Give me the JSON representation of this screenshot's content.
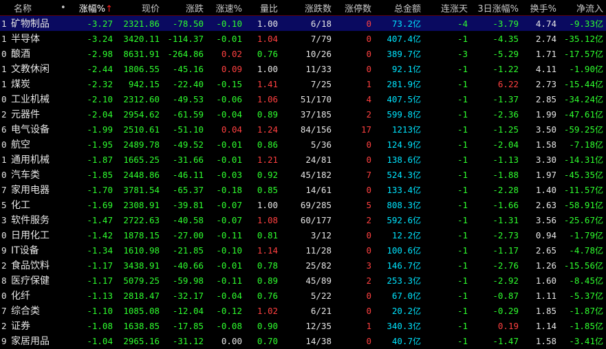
{
  "headers": {
    "name": "名称",
    "dot": "•",
    "change_pct": "涨幅%",
    "sort_arrow": "↑",
    "price": "现价",
    "change": "涨跌",
    "speed": "涨速%",
    "volume_ratio": "量比",
    "up_down_count": "涨跌数",
    "limit_up": "涨停数",
    "total_amount": "总金额",
    "consecutive": "连涨天",
    "three_day": "3日涨幅%",
    "turnover": "换手%",
    "net_inflow": "净流入"
  },
  "colors": {
    "up": "#ff4040",
    "down": "#2fff2f",
    "amount": "#00e5ff",
    "selected_row_bg": "#0a0a60"
  },
  "rows": [
    {
      "idx": "1",
      "name": "矿物制品",
      "pct": "-3.27",
      "price": "2321.86",
      "chg": "-78.50",
      "speed": "-0.10",
      "ratio": "1.00",
      "count": "6/18",
      "limit": "0",
      "amount": "73.2",
      "unit": "亿",
      "days": "-4",
      "three": "-3.79",
      "turn": "4.74",
      "net": "-9.33",
      "net_unit": "亿"
    },
    {
      "idx": "1",
      "name": "半导体",
      "pct": "-3.24",
      "price": "3420.11",
      "chg": "-114.37",
      "speed": "-0.01",
      "ratio": "1.04",
      "count": "7/79",
      "limit": "0",
      "amount": "407.4",
      "unit": "亿",
      "days": "-1",
      "three": "-4.35",
      "turn": "2.74",
      "net": "-35.12",
      "net_unit": "亿"
    },
    {
      "idx": "0",
      "name": "酿酒",
      "pct": "-2.98",
      "price": "8631.91",
      "chg": "-264.86",
      "speed": "0.02",
      "ratio": "0.76",
      "count": "10/26",
      "limit": "0",
      "amount": "389.7",
      "unit": "亿",
      "days": "-3",
      "three": "-5.29",
      "turn": "1.71",
      "net": "-17.57",
      "net_unit": "亿"
    },
    {
      "idx": "1",
      "name": "文教休闲",
      "pct": "-2.44",
      "price": "1806.55",
      "chg": "-45.16",
      "speed": "0.09",
      "ratio": "1.00",
      "count": "11/33",
      "limit": "0",
      "amount": "92.1",
      "unit": "亿",
      "days": "-1",
      "three": "-1.22",
      "turn": "4.11",
      "net": "-1.90",
      "net_unit": "亿"
    },
    {
      "idx": "1",
      "name": "煤炭",
      "pct": "-2.32",
      "price": "942.15",
      "chg": "-22.40",
      "speed": "-0.15",
      "ratio": "1.41",
      "count": "7/25",
      "limit": "1",
      "amount": "281.9",
      "unit": "亿",
      "days": "-1",
      "three": "6.22",
      "turn": "2.73",
      "net": "-15.44",
      "net_unit": "亿"
    },
    {
      "idx": "0",
      "name": "工业机械",
      "pct": "-2.10",
      "price": "2312.60",
      "chg": "-49.53",
      "speed": "-0.06",
      "ratio": "1.06",
      "count": "51/170",
      "limit": "4",
      "amount": "407.5",
      "unit": "亿",
      "days": "-1",
      "three": "-1.37",
      "turn": "2.85",
      "net": "-34.24",
      "net_unit": "亿"
    },
    {
      "idx": "2",
      "name": "元器件",
      "pct": "-2.04",
      "price": "2954.62",
      "chg": "-61.59",
      "speed": "-0.04",
      "ratio": "0.89",
      "count": "37/185",
      "limit": "2",
      "amount": "599.8",
      "unit": "亿",
      "days": "-1",
      "three": "-2.36",
      "turn": "1.99",
      "net": "-47.61",
      "net_unit": "亿"
    },
    {
      "idx": "6",
      "name": "电气设备",
      "pct": "-1.99",
      "price": "2510.61",
      "chg": "-51.10",
      "speed": "0.04",
      "ratio": "1.24",
      "count": "84/156",
      "limit": "17",
      "amount": "1213",
      "unit": "亿",
      "days": "-1",
      "three": "-1.25",
      "turn": "3.50",
      "net": "-59.25",
      "net_unit": "亿"
    },
    {
      "idx": "0",
      "name": "航空",
      "pct": "-1.95",
      "price": "2489.78",
      "chg": "-49.52",
      "speed": "-0.01",
      "ratio": "0.86",
      "count": "5/36",
      "limit": "0",
      "amount": "124.9",
      "unit": "亿",
      "days": "-1",
      "three": "-2.04",
      "turn": "1.58",
      "net": "-7.18",
      "net_unit": "亿"
    },
    {
      "idx": "1",
      "name": "通用机械",
      "pct": "-1.87",
      "price": "1665.25",
      "chg": "-31.66",
      "speed": "-0.01",
      "ratio": "1.21",
      "count": "24/81",
      "limit": "0",
      "amount": "138.6",
      "unit": "亿",
      "days": "-1",
      "three": "-1.13",
      "turn": "3.30",
      "net": "-14.31",
      "net_unit": "亿"
    },
    {
      "idx": "0",
      "name": "汽车类",
      "pct": "-1.85",
      "price": "2448.86",
      "chg": "-46.11",
      "speed": "-0.03",
      "ratio": "0.92",
      "count": "45/182",
      "limit": "7",
      "amount": "524.3",
      "unit": "亿",
      "days": "-1",
      "three": "-1.88",
      "turn": "1.97",
      "net": "-45.35",
      "net_unit": "亿"
    },
    {
      "idx": "7",
      "name": "家用电器",
      "pct": "-1.70",
      "price": "3781.54",
      "chg": "-65.37",
      "speed": "-0.18",
      "ratio": "0.85",
      "count": "14/61",
      "limit": "0",
      "amount": "133.4",
      "unit": "亿",
      "days": "-1",
      "three": "-2.28",
      "turn": "1.40",
      "net": "-11.57",
      "net_unit": "亿"
    },
    {
      "idx": "5",
      "name": "化工",
      "pct": "-1.69",
      "price": "2308.91",
      "chg": "-39.81",
      "speed": "-0.07",
      "ratio": "1.00",
      "count": "69/285",
      "limit": "5",
      "amount": "808.3",
      "unit": "亿",
      "days": "-1",
      "three": "-1.66",
      "turn": "2.63",
      "net": "-58.91",
      "net_unit": "亿"
    },
    {
      "idx": "3",
      "name": "软件服务",
      "pct": "-1.47",
      "price": "2722.63",
      "chg": "-40.58",
      "speed": "-0.07",
      "ratio": "1.08",
      "count": "60/177",
      "limit": "2",
      "amount": "592.6",
      "unit": "亿",
      "days": "-1",
      "three": "-1.31",
      "turn": "3.56",
      "net": "-25.67",
      "net_unit": "亿"
    },
    {
      "idx": "0",
      "name": "日用化工",
      "pct": "-1.42",
      "price": "1878.15",
      "chg": "-27.00",
      "speed": "-0.11",
      "ratio": "0.81",
      "count": "3/12",
      "limit": "0",
      "amount": "12.2",
      "unit": "亿",
      "days": "-1",
      "three": "-2.73",
      "turn": "0.94",
      "net": "-1.79",
      "net_unit": "亿"
    },
    {
      "idx": "9",
      "name": "IT设备",
      "pct": "-1.34",
      "price": "1610.98",
      "chg": "-21.85",
      "speed": "-0.10",
      "ratio": "1.14",
      "count": "11/28",
      "limit": "0",
      "amount": "100.6",
      "unit": "亿",
      "days": "-1",
      "three": "-1.17",
      "turn": "2.65",
      "net": "-4.78",
      "net_unit": "亿"
    },
    {
      "idx": "2",
      "name": "食品饮料",
      "pct": "-1.17",
      "price": "3438.91",
      "chg": "-40.66",
      "speed": "-0.01",
      "ratio": "0.78",
      "count": "25/82",
      "limit": "3",
      "amount": "146.7",
      "unit": "亿",
      "days": "-1",
      "three": "-2.76",
      "turn": "1.26",
      "net": "-15.56",
      "net_unit": "亿"
    },
    {
      "idx": "8",
      "name": "医疗保健",
      "pct": "-1.17",
      "price": "5079.25",
      "chg": "-59.98",
      "speed": "-0.11",
      "ratio": "0.89",
      "count": "45/89",
      "limit": "2",
      "amount": "253.3",
      "unit": "亿",
      "days": "-1",
      "three": "-2.92",
      "turn": "1.60",
      "net": "-8.45",
      "net_unit": "亿"
    },
    {
      "idx": "0",
      "name": "化纤",
      "pct": "-1.13",
      "price": "2818.47",
      "chg": "-32.17",
      "speed": "-0.04",
      "ratio": "0.76",
      "count": "5/22",
      "limit": "0",
      "amount": "67.0",
      "unit": "亿",
      "days": "-1",
      "three": "-0.87",
      "turn": "1.11",
      "net": "-5.37",
      "net_unit": "亿"
    },
    {
      "idx": "7",
      "name": "综合类",
      "pct": "-1.10",
      "price": "1085.08",
      "chg": "-12.04",
      "speed": "-0.12",
      "ratio": "1.02",
      "count": "6/21",
      "limit": "0",
      "amount": "20.2",
      "unit": "亿",
      "days": "-1",
      "three": "-0.29",
      "turn": "1.85",
      "net": "-1.87",
      "net_unit": "亿"
    },
    {
      "idx": "2",
      "name": "证券",
      "pct": "-1.08",
      "price": "1638.85",
      "chg": "-17.85",
      "speed": "-0.08",
      "ratio": "0.90",
      "count": "12/35",
      "limit": "1",
      "amount": "340.3",
      "unit": "亿",
      "days": "-1",
      "three": "0.19",
      "turn": "1.14",
      "net": "-1.85",
      "net_unit": "亿"
    },
    {
      "idx": "9",
      "name": "家居用品",
      "pct": "-1.04",
      "price": "2965.16",
      "chg": "-31.12",
      "speed": "0.00",
      "ratio": "0.70",
      "count": "14/38",
      "limit": "0",
      "amount": "40.7",
      "unit": "亿",
      "days": "-1",
      "three": "-1.47",
      "turn": "1.58",
      "net": "-3.41",
      "net_unit": "亿"
    }
  ]
}
